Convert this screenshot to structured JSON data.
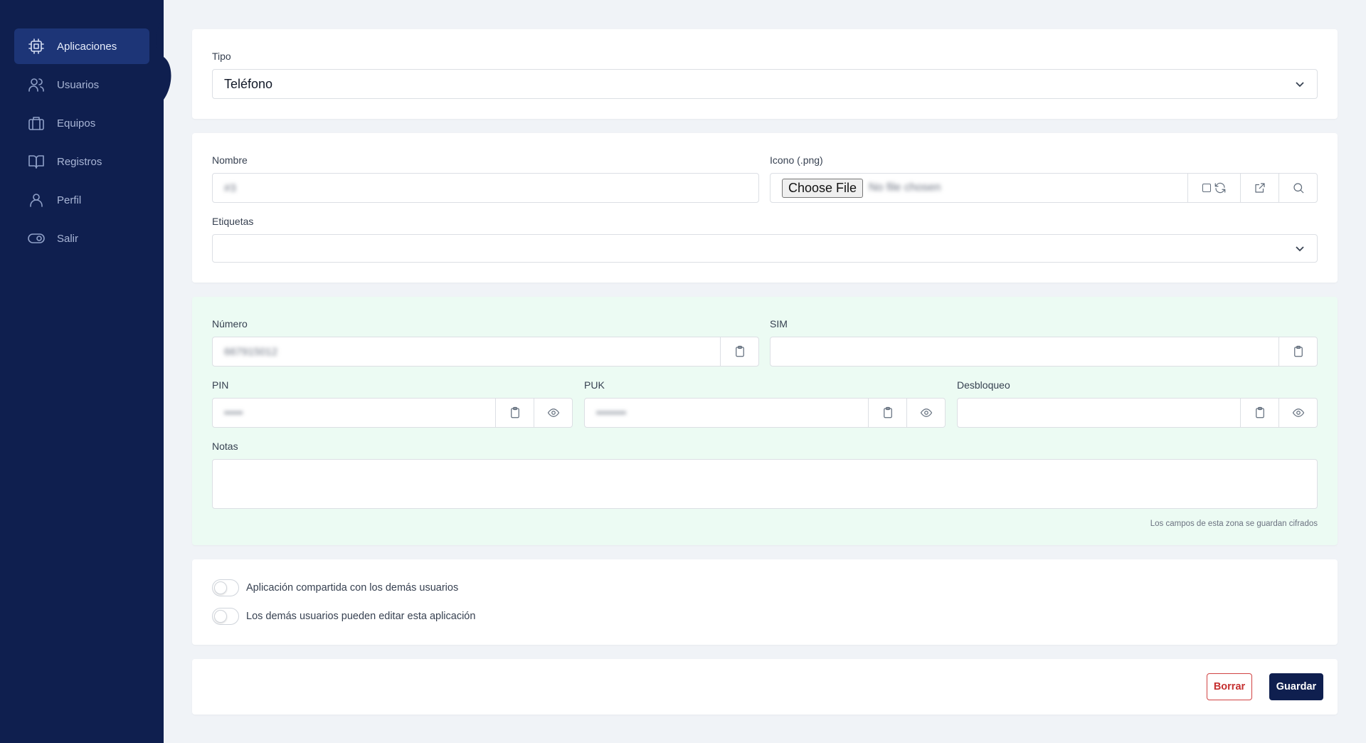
{
  "sidebar": {
    "items": [
      {
        "label": "Aplicaciones",
        "icon": "chip-icon",
        "active": true
      },
      {
        "label": "Usuarios",
        "icon": "users-icon"
      },
      {
        "label": "Equipos",
        "icon": "briefcase-icon"
      },
      {
        "label": "Registros",
        "icon": "book-icon"
      },
      {
        "label": "Perfil",
        "icon": "user-icon"
      },
      {
        "label": "Salir",
        "icon": "toggle-icon"
      }
    ]
  },
  "tipo": {
    "label": "Tipo",
    "value": "Teléfono"
  },
  "general": {
    "nombre_label": "Nombre",
    "nombre_value": "#3",
    "icono_label": "Icono (.png)",
    "choose_file": "Choose File",
    "no_file": "No file chosen",
    "etiquetas_label": "Etiquetas"
  },
  "encrypted": {
    "numero_label": "Número",
    "numero_value": "667915012",
    "sim_label": "SIM",
    "pin_label": "PIN",
    "pin_value": "•••••",
    "puk_label": "PUK",
    "puk_value": "••••••••",
    "desbloqueo_label": "Desbloqueo",
    "notas_label": "Notas",
    "hint": "Los campos de esta zona se guardan cifrados"
  },
  "sharing": {
    "shared_label": "Aplicación compartida con los demás usuarios",
    "editable_label": "Los demás usuarios pueden editar esta aplicación"
  },
  "actions": {
    "delete": "Borrar",
    "save": "Guardar"
  },
  "colors": {
    "sidebar": "#0f1f4f",
    "active": "#1d3577",
    "encrypted_zone": "#ecfbf3",
    "danger": "#c53030"
  }
}
